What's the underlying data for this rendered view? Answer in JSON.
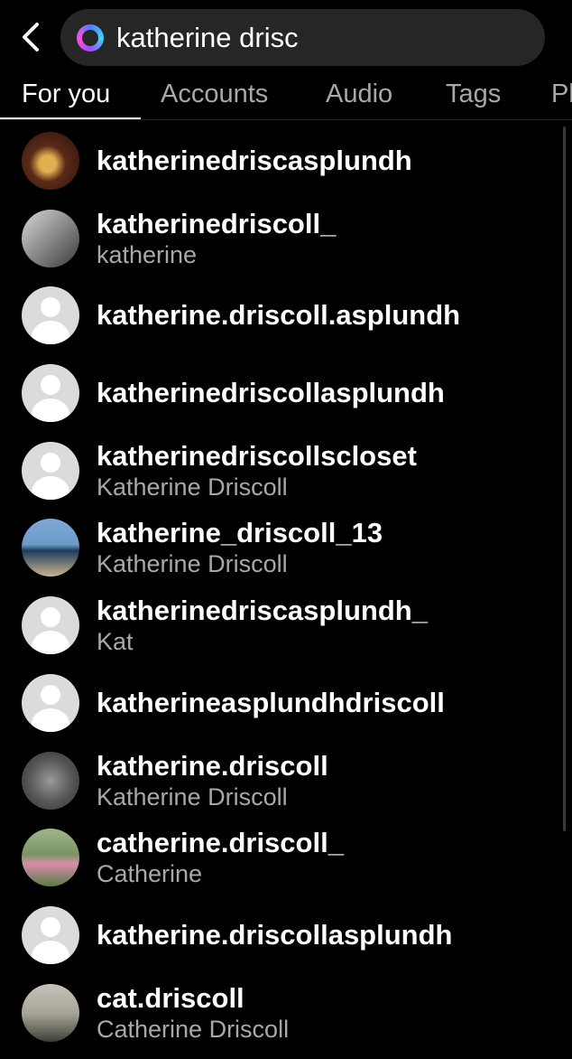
{
  "search": {
    "query": "katherine drisc"
  },
  "tabs": [
    {
      "label": "For you",
      "active": true
    },
    {
      "label": "Accounts",
      "active": false
    },
    {
      "label": "Audio",
      "active": false
    },
    {
      "label": "Tags",
      "active": false
    },
    {
      "label": "Pl",
      "active": false
    }
  ],
  "results": [
    {
      "username": "katherinedriscasplundh",
      "fullname": "",
      "avatar": "photo"
    },
    {
      "username": "katherinedriscoll_",
      "fullname": "katherine",
      "avatar": "photo"
    },
    {
      "username": "katherine.driscoll.asplundh",
      "fullname": "",
      "avatar": "default"
    },
    {
      "username": "katherinedriscollasplundh",
      "fullname": "",
      "avatar": "default"
    },
    {
      "username": "katherinedriscollscloset",
      "fullname": "Katherine Driscoll",
      "avatar": "default"
    },
    {
      "username": "katherine_driscoll_13",
      "fullname": "Katherine Driscoll",
      "avatar": "photo"
    },
    {
      "username": "katherinedriscasplundh_",
      "fullname": "Kat",
      "avatar": "default"
    },
    {
      "username": "katherineasplundhdriscoll",
      "fullname": "",
      "avatar": "default"
    },
    {
      "username": "katherine.driscoll",
      "fullname": "Katherine Driscoll",
      "avatar": "photo"
    },
    {
      "username": "catherine.driscoll_",
      "fullname": "Catherine",
      "avatar": "photo"
    },
    {
      "username": "katherine.driscollasplundh",
      "fullname": "",
      "avatar": "default"
    },
    {
      "username": "cat.driscoll",
      "fullname": "Catherine Driscoll",
      "avatar": "photo"
    }
  ],
  "icons": {
    "back": "chevron-left-icon",
    "search_ai": "meta-ai-ring-icon"
  },
  "colors": {
    "background": "#000000",
    "search_bar": "#262626",
    "secondary_text": "#a8a8a8",
    "primary_text": "#ffffff"
  }
}
